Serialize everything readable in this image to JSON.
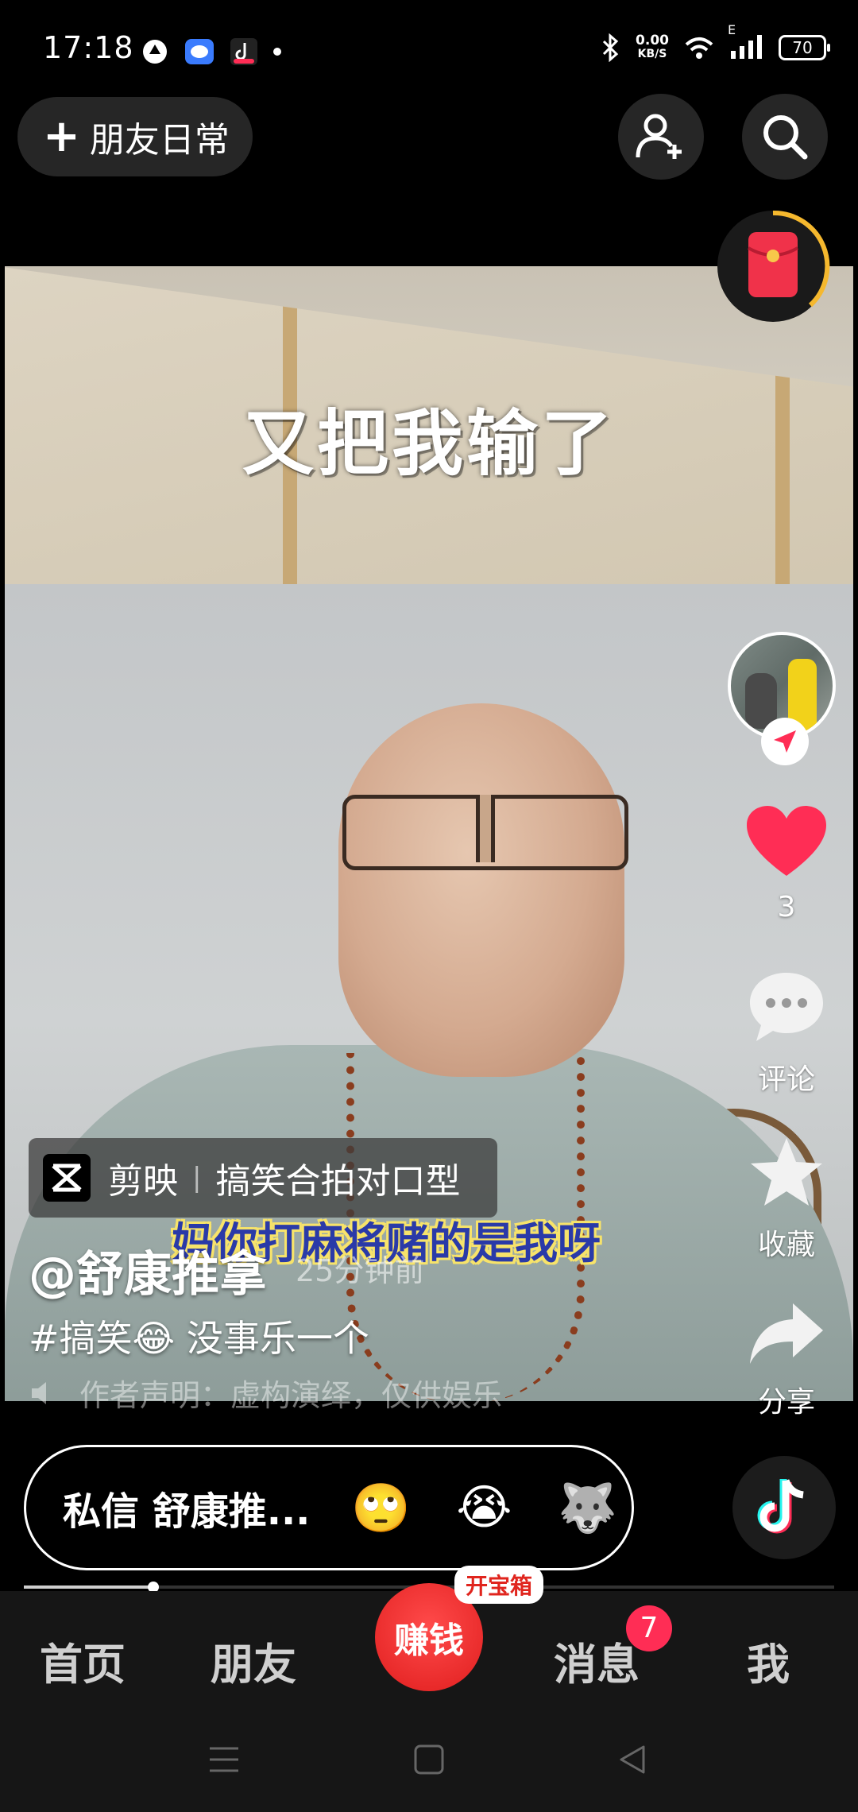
{
  "status_bar": {
    "time": "17:18",
    "net_speed_value": "0.00",
    "net_speed_unit": "KB/S",
    "signal_label": "E",
    "battery": "70"
  },
  "top": {
    "friends_daily_label": "朋友日常",
    "add_friend_icon": "add-user-icon",
    "search_icon": "search-icon",
    "red_packet_icon": "red-packet-icon"
  },
  "video": {
    "title_overlay": "又把我输了",
    "subtitle_overlay": "妈你打麻将赌的是我呀"
  },
  "actions": {
    "like_count": "3",
    "comment_label": "评论",
    "favorite_label": "收藏",
    "share_label": "分享"
  },
  "info": {
    "capcut_label": "剪映",
    "capcut_template": "搞笑合拍对口型",
    "author": "@舒康推拿",
    "time_ago": "25分钟前",
    "description": "#搞笑😂 没事乐一个",
    "disclaimer": "作者声明：虚构演绎，仅供娱乐"
  },
  "dm_bar": {
    "label": "私信 舒康推...",
    "emojis": [
      "🙄",
      "😭",
      "🐺"
    ]
  },
  "progress": {
    "value": 0.16
  },
  "nav": {
    "home": "首页",
    "friends": "朋友",
    "earn": "赚钱",
    "treasure": "开宝箱",
    "messages": "消息",
    "messages_badge": "7",
    "me": "我"
  },
  "colors": {
    "like": "#ff2d55",
    "earn": "#e82a2a",
    "subtitle_fill": "#2a3aa8",
    "subtitle_outline": "#f7e36a"
  }
}
